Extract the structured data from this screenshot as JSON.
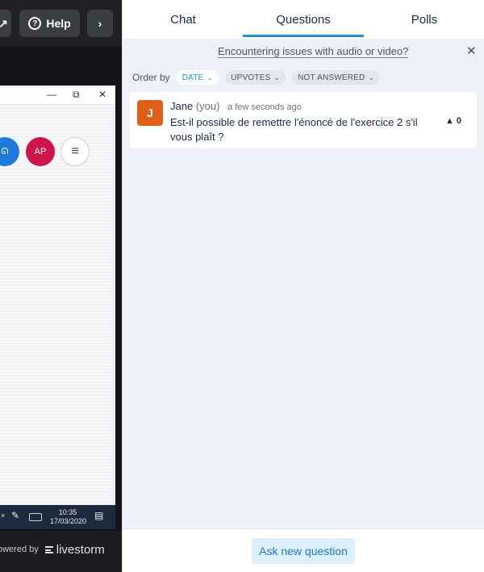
{
  "header": {
    "help_label": "Help",
    "help_icon_glyph": "?",
    "next_icon_glyph": "›",
    "expand_icon_glyph": "↗"
  },
  "shared_window": {
    "min_glyph": "—",
    "restore_glyph": "⧉",
    "close_glyph": "✕",
    "user_icon_glyph": "ᘏ",
    "ap_label": "AP",
    "menu_icon_glyph": "≡"
  },
  "taskbar": {
    "close_glyph": "×",
    "pen_glyph": "✎",
    "time": "10:35",
    "date": "17/03/2020",
    "notif_glyph": "▤"
  },
  "footer_brand": {
    "powered_text": "owered by",
    "brand_name": "livestorm"
  },
  "tabs": [
    {
      "label": "Chat"
    },
    {
      "label": "Questions"
    },
    {
      "label": "Polls"
    }
  ],
  "issue_bar": {
    "link_text": "Encountering issues with audio or video?",
    "close_glyph": "✕"
  },
  "order_bar": {
    "label": "Order by",
    "chips": [
      {
        "label": "DATE"
      },
      {
        "label": "UPVOTES"
      },
      {
        "label": "NOT ANSWERED"
      }
    ]
  },
  "question": {
    "avatar_initial": "J",
    "author": "Jane",
    "you_tag": "(you)",
    "time": "a few seconds ago",
    "text": "Est-il possible de remettre l'énoncé de l'exercice 2 s'il vous plaît ?",
    "upvote_glyph": "▲",
    "upvote_count": "0"
  },
  "panel_footer": {
    "ask_label": "Ask new question"
  },
  "colors": {
    "accent": "#1e94e0",
    "avatar_orange": "#e0601a",
    "ap_red": "#d0154b",
    "user_blue": "#1f7ae0"
  }
}
